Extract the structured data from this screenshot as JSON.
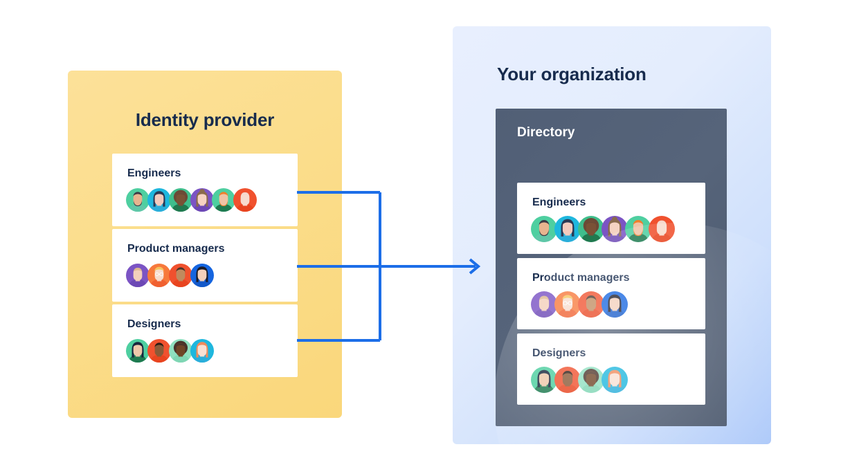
{
  "diagram": {
    "title_left": "Identity provider",
    "title_right": "Your organization",
    "directory_label": "Directory",
    "colors": {
      "idp_panel": "#FBDD8B",
      "org_panel_light": "#E8EFFE",
      "org_panel_dark": "#ADC9F9",
      "directory_panel": "#56647A",
      "card_bg": "#FFFFFF",
      "heading_text": "#172B4D",
      "directory_text": "#FFFFFF",
      "arrow": "#1C6EE8"
    }
  },
  "identity_provider": {
    "title": "Identity provider",
    "groups": [
      {
        "name": "Engineers",
        "members": [
          {
            "ring": "#4ECFA0",
            "hair": "#3C3C46",
            "skin": "#E8B48F",
            "shirt": "#5FC7A8",
            "style": "beard"
          },
          {
            "ring": "#1EB7DE",
            "hair": "#2B3A55",
            "skin": "#F3CBBE",
            "shirt": "#2AAEDA",
            "style": "bob"
          },
          {
            "ring": "#3FBE8C",
            "hair": "#6B4A36",
            "skin": "#7A5236",
            "shirt": "#20794F",
            "style": "afro"
          },
          {
            "ring": "#7B54C4",
            "hair": "#8A6A4C",
            "skin": "#F6D3C2",
            "shirt": "#6C48B5",
            "style": "bun"
          },
          {
            "ring": "#4ECFA0",
            "hair": "#F07F2B",
            "skin": "#F0C3A6",
            "shirt": "#1E7A50",
            "style": "ginger-beard"
          },
          {
            "ring": "#F0512E",
            "hair": "#F6D8CC",
            "skin": "#F7DCCE",
            "shirt": "#E8441F",
            "style": "plain"
          }
        ]
      },
      {
        "name": "Product managers",
        "members": [
          {
            "ring": "#7B54C4",
            "hair": "#D8B48A",
            "skin": "#F3D0BB",
            "shirt": "#6C48B5",
            "style": "plain"
          },
          {
            "ring": "#F7793C",
            "hair": "#F6C35C",
            "skin": "#F7DCCE",
            "shirt": "#F06030",
            "style": "glasses"
          },
          {
            "ring": "#F0512E",
            "hair": "#4A352A",
            "skin": "#C08A5E",
            "shirt": "#E8441F",
            "style": "short"
          },
          {
            "ring": "#1565E0",
            "hair": "#1C1C28",
            "skin": "#F3D0BB",
            "shirt": "#1358C9",
            "style": "long"
          }
        ]
      },
      {
        "name": "Designers",
        "members": [
          {
            "ring": "#4ECFA0",
            "hair": "#17263C",
            "skin": "#EEC8AA",
            "shirt": "#1E7A50",
            "style": "bob"
          },
          {
            "ring": "#F0512E",
            "hair": "#2D1C14",
            "skin": "#8A5A38",
            "shirt": "#E8441F",
            "style": "short"
          },
          {
            "ring": "#8FE0C0",
            "hair": "#4A332A",
            "skin": "#6F4527",
            "shirt": "#7FD6B4",
            "style": "afro"
          },
          {
            "ring": "#1EB7DE",
            "hair": "#F08B5B",
            "skin": "#F9E0D3",
            "shirt": "#2AAEDA",
            "style": "long"
          }
        ]
      }
    ]
  },
  "organization": {
    "title": "Your organization",
    "directory": {
      "label": "Directory",
      "groups": [
        {
          "name": "Engineers",
          "members": [
            {
              "ring": "#4ECFA0",
              "hair": "#3C3C46",
              "skin": "#E8B48F",
              "shirt": "#5FC7A8",
              "style": "beard"
            },
            {
              "ring": "#1EB7DE",
              "hair": "#2B3A55",
              "skin": "#F3CBBE",
              "shirt": "#2AAEDA",
              "style": "bob"
            },
            {
              "ring": "#3FBE8C",
              "hair": "#6B4A36",
              "skin": "#7A5236",
              "shirt": "#20794F",
              "style": "afro"
            },
            {
              "ring": "#7B54C4",
              "hair": "#8A6A4C",
              "skin": "#F6D3C2",
              "shirt": "#6C48B5",
              "style": "bun"
            },
            {
              "ring": "#4ECFA0",
              "hair": "#F07F2B",
              "skin": "#F0C3A6",
              "shirt": "#1E7A50",
              "style": "ginger-beard"
            },
            {
              "ring": "#F0512E",
              "hair": "#F6D8CC",
              "skin": "#F7DCCE",
              "shirt": "#E8441F",
              "style": "plain"
            }
          ]
        },
        {
          "name": "Product managers",
          "members": [
            {
              "ring": "#7B54C4",
              "hair": "#D8B48A",
              "skin": "#F3D0BB",
              "shirt": "#6C48B5",
              "style": "plain"
            },
            {
              "ring": "#F7793C",
              "hair": "#F6C35C",
              "skin": "#F7DCCE",
              "shirt": "#F06030",
              "style": "glasses"
            },
            {
              "ring": "#F0512E",
              "hair": "#4A352A",
              "skin": "#C08A5E",
              "shirt": "#E8441F",
              "style": "short"
            },
            {
              "ring": "#1565E0",
              "hair": "#1C1C28",
              "skin": "#F3D0BB",
              "shirt": "#1358C9",
              "style": "long"
            }
          ]
        },
        {
          "name": "Designers",
          "members": [
            {
              "ring": "#4ECFA0",
              "hair": "#17263C",
              "skin": "#EEC8AA",
              "shirt": "#1E7A50",
              "style": "bob"
            },
            {
              "ring": "#F0512E",
              "hair": "#2D1C14",
              "skin": "#8A5A38",
              "shirt": "#E8441F",
              "style": "short"
            },
            {
              "ring": "#8FE0C0",
              "hair": "#4A332A",
              "skin": "#6F4527",
              "shirt": "#7FD6B4",
              "style": "afro"
            },
            {
              "ring": "#1EB7DE",
              "hair": "#F08B5B",
              "skin": "#F9E0D3",
              "shirt": "#2AAEDA",
              "style": "long"
            }
          ]
        }
      ]
    }
  },
  "connector": {
    "name": "sync-arrow",
    "color": "#1C6EE8",
    "stroke_width": 4,
    "direction": "left-to-right"
  }
}
